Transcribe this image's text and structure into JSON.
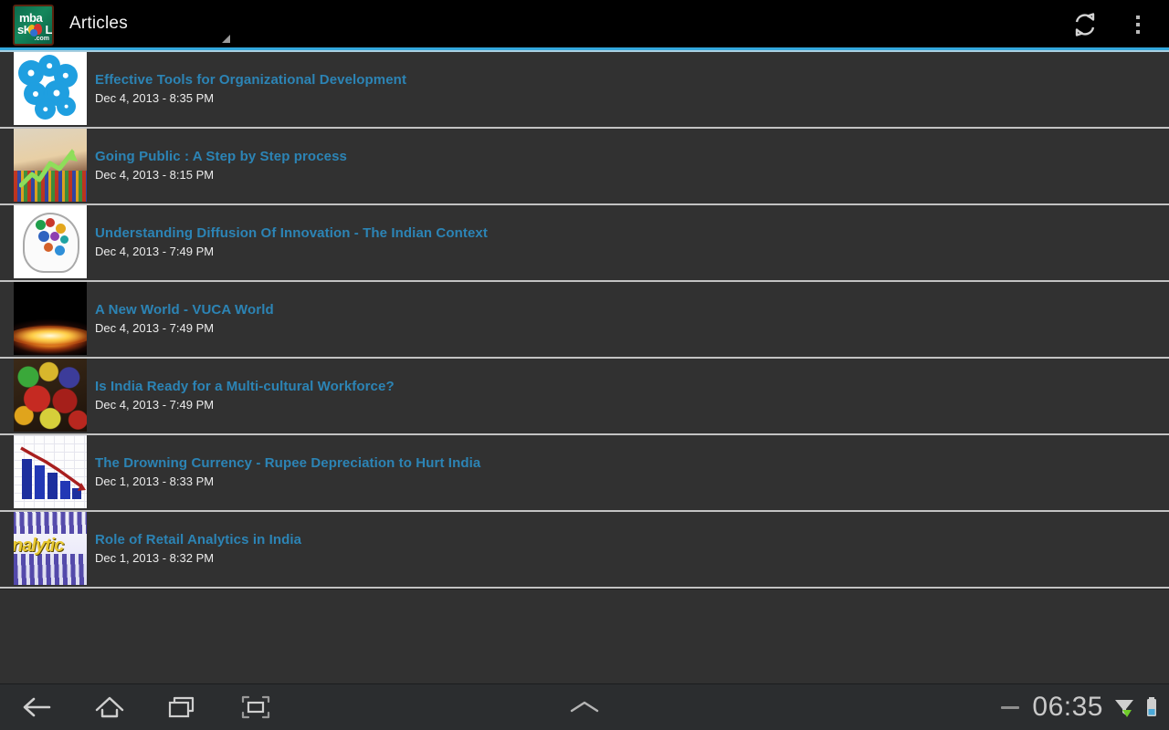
{
  "action_bar": {
    "title": "Articles",
    "logo": {
      "line1": "mba",
      "line2": "sK",
      "line2_tail": "L",
      "domain": ".com",
      "alt": "mbaskool.com logo"
    },
    "refresh_icon": "refresh-icon",
    "overflow_icon": "overflow-menu-icon",
    "spinner_caret_icon": "spinner-caret-icon",
    "accent_color": "#33a8dd"
  },
  "list": {
    "title_color": "#2c84b5",
    "date_color": "#ececec",
    "background_color": "#313131",
    "divider_color": "#c3c3c3",
    "items": [
      {
        "title": "Effective Tools for Organizational Development",
        "date": "Dec 4, 2013 - 8:35 PM",
        "thumb": "blue-gears-cluster-thumbnail"
      },
      {
        "title": "Going Public : A Step by Step process",
        "date": "Dec 4, 2013 - 8:15 PM",
        "thumb": "rising-green-arrow-chart-thumbnail"
      },
      {
        "title": "Understanding Diffusion Of Innovation - The Indian Context",
        "date": "Dec 4, 2013 - 7:49 PM",
        "thumb": "head-with-colorful-gears-thumbnail"
      },
      {
        "title": "A New World - VUCA World",
        "date": "Dec 4, 2013 - 7:49 PM",
        "thumb": "sunrise-over-horizon-thumbnail"
      },
      {
        "title": "Is India Ready for a Multi-cultural Workforce?",
        "date": "Dec 4, 2013 - 7:49 PM",
        "thumb": "colorful-masks-crowd-thumbnail"
      },
      {
        "title": "The Drowning Currency - Rupee Depreciation to Hurt India",
        "date": "Dec 1, 2013 - 8:33 PM",
        "thumb": "declining-bar-chart-thumbnail"
      },
      {
        "title": "Role of Retail Analytics in India",
        "date": "Dec 1, 2013 - 8:32 PM",
        "thumb": "analytics-word-graphic-thumbnail"
      }
    ]
  },
  "nav_bar": {
    "back_icon": "back-arrow-icon",
    "home_icon": "home-icon",
    "recents_icon": "recent-apps-icon",
    "screenshot_icon": "screenshot-icon",
    "drawer_handle_icon": "chevron-up-icon",
    "clock": "06:35",
    "minus_icon": "minus-icon",
    "signal_icon": "wifi-signal-icon",
    "battery_icon": "battery-icon"
  }
}
